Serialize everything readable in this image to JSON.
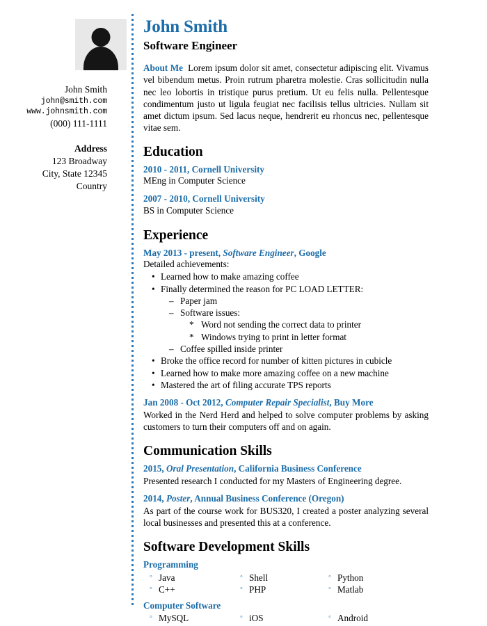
{
  "sidebar": {
    "avatar_alt": "person-silhouette",
    "contact": {
      "name": "John Smith",
      "email": "john@smith.com",
      "website": "www.johnsmith.com",
      "phone": "(000) 111-1111"
    },
    "address": {
      "title": "Address",
      "line1": "123 Broadway",
      "line2": "City, State 12345",
      "line3": "Country"
    }
  },
  "header": {
    "name": "John Smith",
    "job_title": "Software Engineer"
  },
  "about": {
    "label": "About Me",
    "text": "Lorem ipsum dolor sit amet, consectetur adipiscing elit. Vivamus vel bibendum metus. Proin rutrum pharetra molestie. Cras sollicitudin nulla nec leo lobortis in tristique purus pretium. Ut eu felis nulla. Pellentesque condimentum justo ut ligula feugiat nec facilisis tellus ultricies. Nullam sit amet dictum ipsum. Sed lacus neque, hendrerit eu rhoncus nec, pellentesque vitae sem."
  },
  "education": {
    "title": "Education",
    "entries": [
      {
        "head": "2010 - 2011, Cornell University",
        "sub": "MEng in Computer Science"
      },
      {
        "head": "2007 - 2010, Cornell University",
        "sub": "BS in Computer Science"
      }
    ]
  },
  "experience": {
    "title": "Experience",
    "job1": {
      "date": "May 2013 - present, ",
      "role": "Software Engineer",
      "company": ", Google",
      "sub": "Detailed achievements:",
      "bullets": {
        "b1": "Learned how to make amazing coffee",
        "b2": "Finally determined the reason for PC LOAD LETTER:",
        "b2_1": "Paper jam",
        "b2_2": "Software issues:",
        "b2_2_1": "Word not sending the correct data to printer",
        "b2_2_2": "Windows trying to print in letter format",
        "b2_3": "Coffee spilled inside printer",
        "b3": "Broke the office record for number of kitten pictures in cubicle",
        "b4": "Learned how to make more amazing coffee on a new machine",
        "b5": "Mastered the art of filing accurate TPS reports"
      },
      "marks": {
        "level1": "•",
        "level2": "–",
        "level3": "*"
      }
    },
    "job2": {
      "date": "Jan 2008 - Oct 2012, ",
      "role": "Computer Repair Specialist",
      "company": ", Buy More",
      "desc": "Worked in the Nerd Herd and helped to solve computer problems by asking customers to turn their computers off and on again."
    }
  },
  "communication": {
    "title": "Communication Skills",
    "entries": [
      {
        "year": "2015, ",
        "kind": "Oral Presentation",
        "venue": ", California Business Conference",
        "desc": "Presented research I conducted for my Masters of Engineering degree."
      },
      {
        "year": "2014, ",
        "kind": "Poster",
        "venue": ", Annual Business Conference (Oregon)",
        "desc": "As part of the course work for BUS320, I created a poster analyzing several local businesses and presented this at a conference."
      }
    ]
  },
  "dev_skills": {
    "title": "Software Development Skills",
    "bullet": "◦",
    "groups": [
      {
        "name": "Programming",
        "items": [
          "Java",
          "Shell",
          "Python",
          "C++",
          "PHP",
          "Matlab"
        ]
      },
      {
        "name": "Computer Software",
        "items": [
          "MySQL",
          "iOS",
          "Android"
        ]
      }
    ]
  },
  "colors": {
    "accent": "#1b6ca8",
    "divider": "#2b7bbd",
    "avatar_bg": "#e8e8e8"
  }
}
